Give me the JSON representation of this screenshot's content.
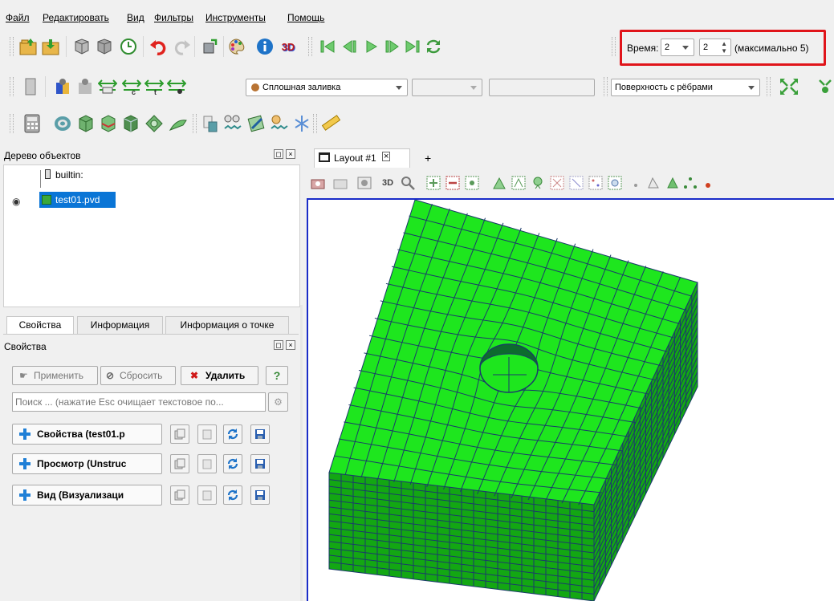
{
  "menu": [
    "Файл",
    "Редактировать",
    "Вид",
    "Фильтры",
    "Инструменты",
    "Помощь"
  ],
  "time": {
    "label": "Время:",
    "value": "2",
    "index": "2",
    "max": "(максимально 5)"
  },
  "toolbar2": {
    "color_mode": "Сплошная заливка",
    "representation": "Поверхность с рёбрами"
  },
  "pipeline": {
    "title": "Дерево объектов",
    "builtin": "builtin:",
    "item": "test01.pvd"
  },
  "props_tabs": [
    "Свойства",
    "Информация",
    "Информация о точке"
  ],
  "props": {
    "title": "Свойства",
    "apply": "Применить",
    "reset": "Сбросить",
    "delete": "Удалить",
    "help": "?",
    "search_placeholder": "Поиск ... (нажатие Esc очищает текстовое по...",
    "sections": [
      "Свойства (test01.p",
      "Просмотр (Unstruc",
      "Вид (Визуализаци"
    ]
  },
  "view": {
    "tab": "Layout #1",
    "add": "+",
    "btn_3d": "3D"
  },
  "toolbar1": {
    "btn_3d": "3D"
  },
  "colors": {
    "mesh": "#1ee61e",
    "mesh_dark": "#13a713",
    "edge": "#1b3a6b",
    "highlight": "#e0141a",
    "render_border": "#1a2cc8"
  }
}
